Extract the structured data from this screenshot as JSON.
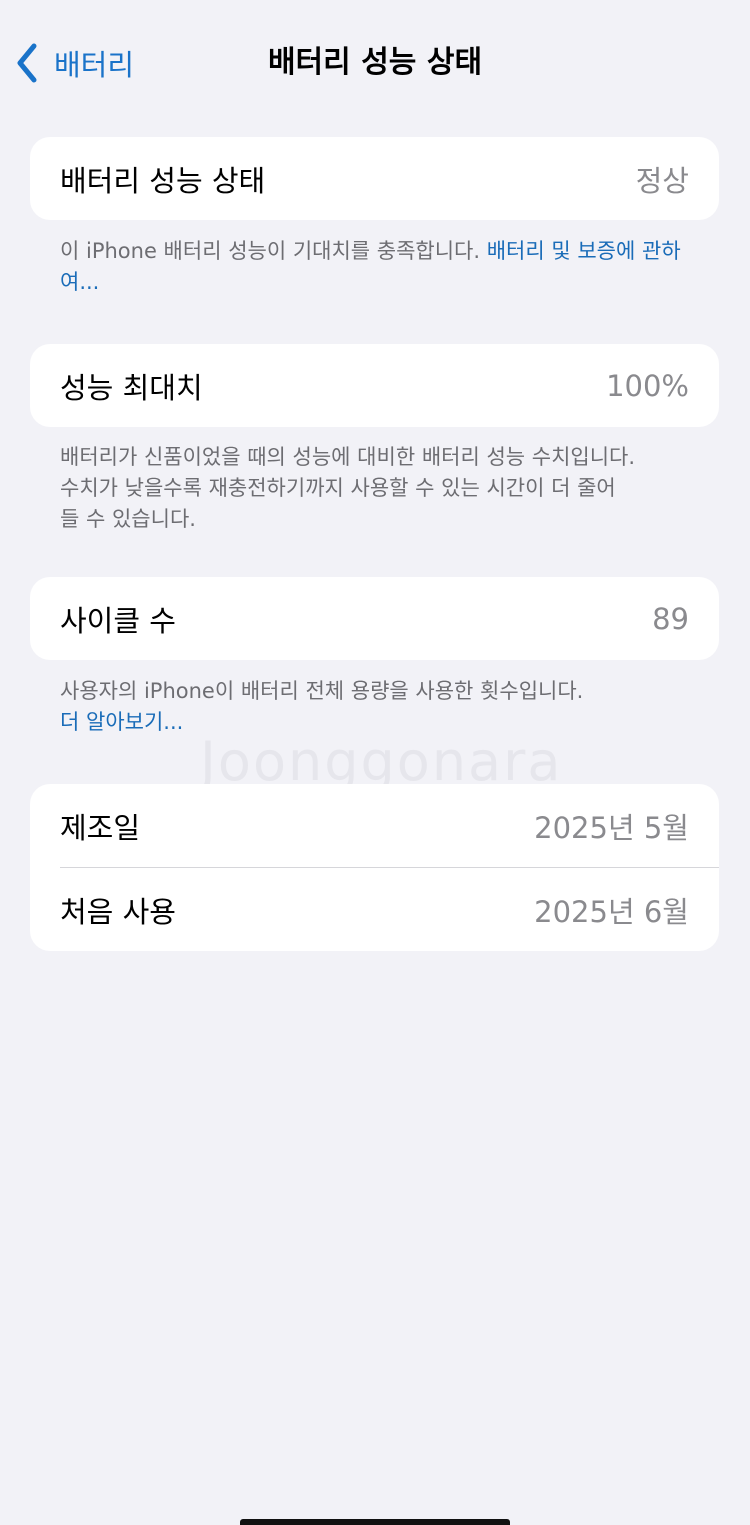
{
  "nav": {
    "back_label": "배터리",
    "title": "배터리 성능 상태"
  },
  "health": {
    "label": "배터리 성능 상태",
    "value": "정상",
    "footnote_text": "이 iPhone 배터리 성능이 기대치를 충족합니다. ",
    "footnote_link": "배터리 및 보증에 관하여..."
  },
  "capacity": {
    "label": "성능 최대치",
    "value": "100%",
    "footnote_line1": "배터리가 신품이었을 때의 성능에 대비한 배터리 성능 수치입니다.",
    "footnote_line2": "수치가 낮을수록 재충전하기까지 사용할 수 있는 시간이 더 줄어",
    "footnote_line3": "들 수 있습니다."
  },
  "cycles": {
    "label": "사이클 수",
    "value": "89",
    "footnote_text": "사용자의 iPhone이 배터리 전체 용량을 사용한 횟수입니다.",
    "footnote_link": "더 알아보기..."
  },
  "dates": {
    "manufactured_label": "제조일",
    "manufactured_value": "2025년 5월",
    "first_use_label": "처음 사용",
    "first_use_value": "2025년 6월"
  },
  "watermark": "Joonggonara",
  "colors": {
    "accent": "#1a73c9",
    "background": "#f2f2f7",
    "secondary_text": "#8a8a8e"
  },
  "icons": {
    "back": "chevron-left-icon"
  }
}
